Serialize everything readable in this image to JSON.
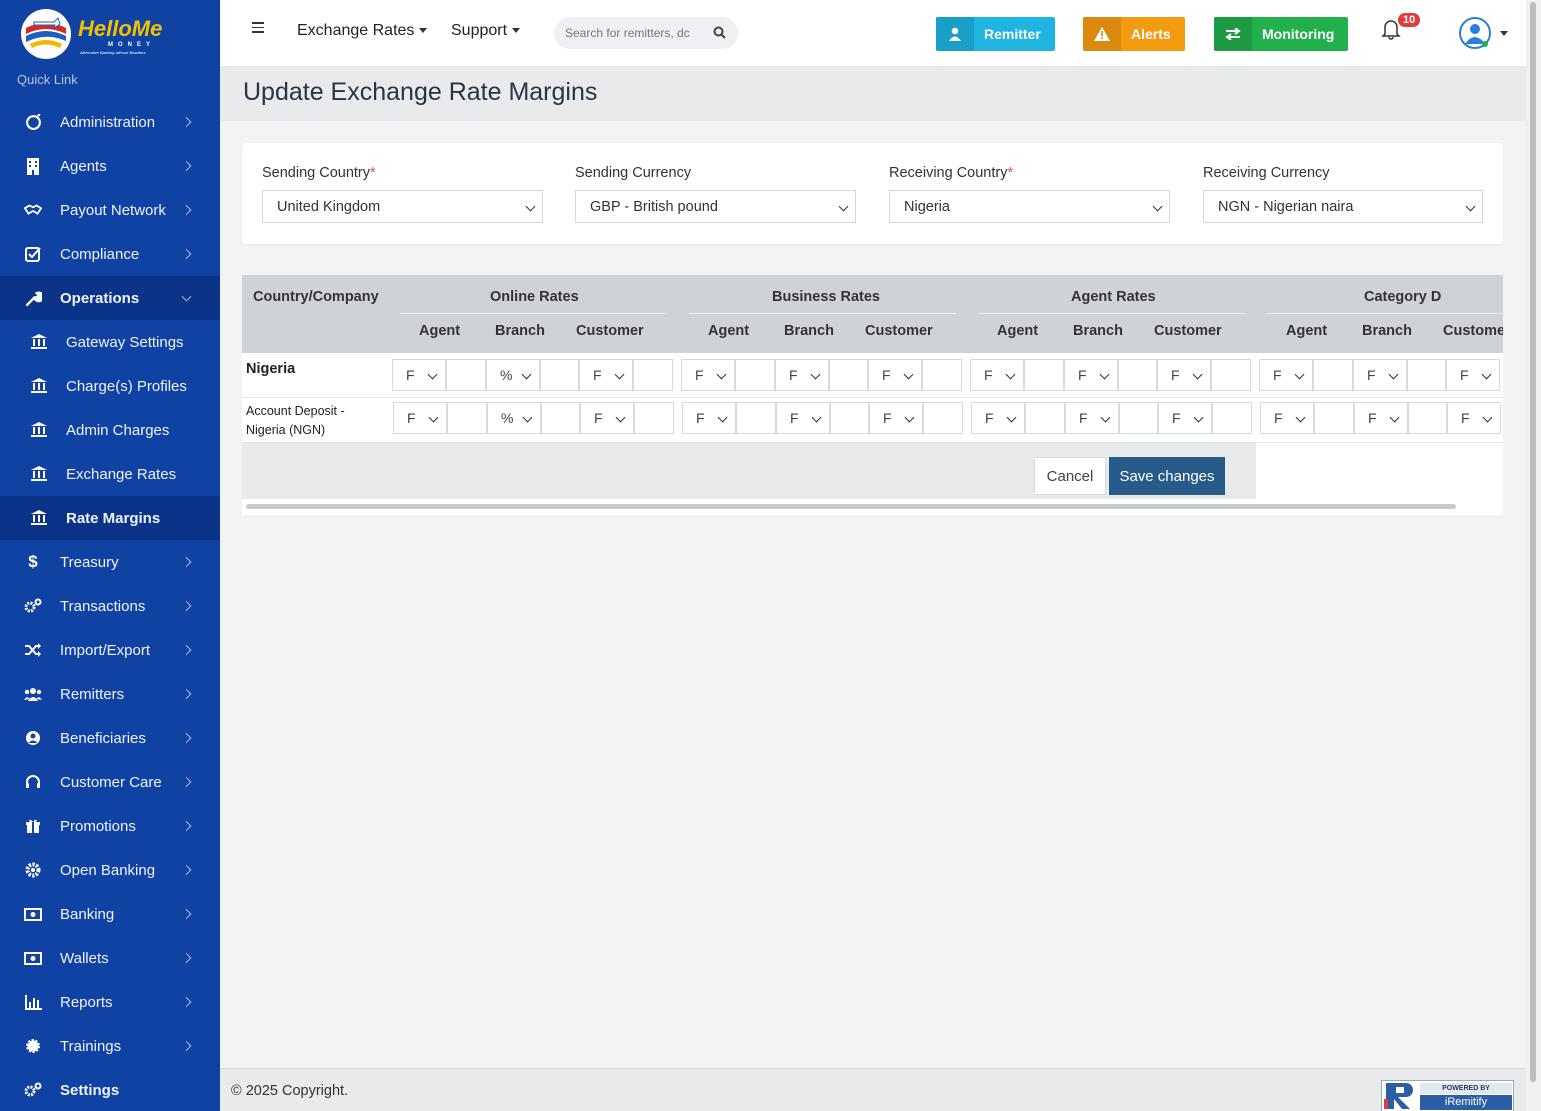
{
  "brand": {
    "name": "HelloMe",
    "sub": "MONEY",
    "tagline": "Alternative Banking without Boarders"
  },
  "sidebar": {
    "quick_link": "Quick Link",
    "items": [
      {
        "label": "Administration",
        "icon": "circle-slash-icon"
      },
      {
        "label": "Agents",
        "icon": "building-icon"
      },
      {
        "label": "Payout Network",
        "icon": "handshake-icon"
      },
      {
        "label": "Compliance",
        "icon": "check-square-icon"
      },
      {
        "label": "Operations",
        "icon": "wrench-icon"
      },
      {
        "label": "Treasury",
        "icon": "dollar-icon"
      },
      {
        "label": "Transactions",
        "icon": "cogs-icon"
      },
      {
        "label": "Import/Export",
        "icon": "shuffle-icon"
      },
      {
        "label": "Remitters",
        "icon": "users-icon"
      },
      {
        "label": "Beneficiaries",
        "icon": "user-circle-icon"
      },
      {
        "label": "Customer Care",
        "icon": "headset-icon"
      },
      {
        "label": "Promotions",
        "icon": "gift-icon"
      },
      {
        "label": "Open Banking",
        "icon": "gear-icon"
      },
      {
        "label": "Banking",
        "icon": "money-bill-icon"
      },
      {
        "label": "Wallets",
        "icon": "money-bill-icon"
      },
      {
        "label": "Reports",
        "icon": "bar-chart-icon"
      },
      {
        "label": "Trainings",
        "icon": "cog-icon"
      },
      {
        "label": "Settings",
        "icon": "cogs-icon"
      }
    ],
    "operations_sub": [
      {
        "label": "Gateway Settings"
      },
      {
        "label": "Charge(s) Profiles"
      },
      {
        "label": "Admin Charges"
      },
      {
        "label": "Exchange Rates"
      },
      {
        "label": "Rate Margins"
      }
    ]
  },
  "header": {
    "menu_exchange": "Exchange Rates",
    "menu_support": "Support",
    "search_placeholder": "Search for remitters, dc",
    "btn_remitter": "Remitter",
    "btn_alerts": "Alerts",
    "btn_monitoring": "Monitoring",
    "notifications": "10",
    "colors": {
      "remitter": "#1fb5e0",
      "alerts": "#f39c12",
      "monitoring": "#21b04b"
    }
  },
  "page": {
    "title": "Update Exchange Rate Margins"
  },
  "filters": {
    "sending_country_label": "Sending Country",
    "sending_country": "United Kingdom",
    "sending_currency_label": "Sending Currency",
    "sending_currency": "GBP - British pound",
    "receiving_country_label": "Receiving Country",
    "receiving_country": "Nigeria",
    "receiving_currency_label": "Receiving Currency",
    "receiving_currency": "NGN - Nigerian naira",
    "required_mark": "*"
  },
  "table": {
    "col_country": "Country/Company",
    "groups": [
      "Online Rates",
      "Business Rates",
      "Agent Rates",
      "Category D"
    ],
    "subcols": [
      "Agent",
      "Branch",
      "Customer"
    ],
    "rows": [
      {
        "label": "Nigeria",
        "selects": [
          "F",
          "%",
          "F",
          "F",
          "F",
          "F",
          "F",
          "F",
          "F",
          "F",
          "F",
          "F"
        ]
      },
      {
        "label": "Account Deposit - Nigeria (NGN)",
        "selects": [
          "F",
          "%",
          "F",
          "F",
          "F",
          "F",
          "F",
          "F",
          "F",
          "F",
          "F",
          "F"
        ]
      }
    ]
  },
  "actions": {
    "cancel": "Cancel",
    "save": "Save changes"
  },
  "footer": {
    "copyright": "© 2025 Copyright.",
    "powered_by": "POWERED BY",
    "powered_name": "iRemitify"
  }
}
